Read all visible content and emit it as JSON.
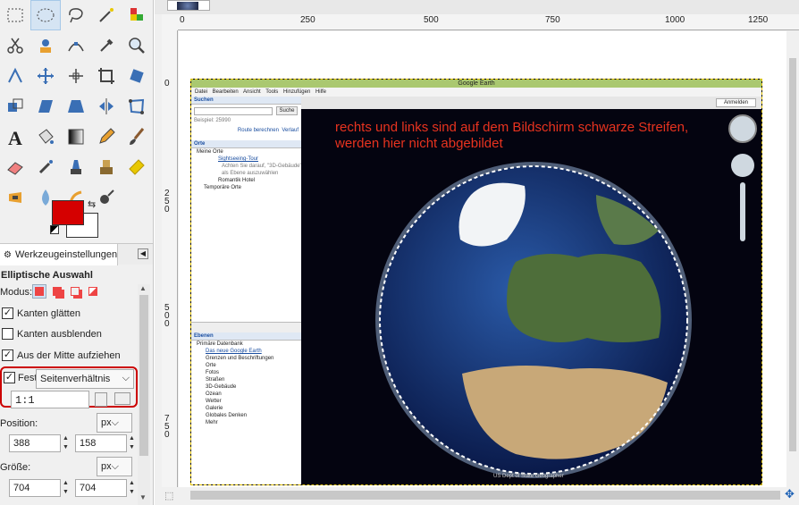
{
  "toolbox": {
    "tools": [
      {
        "icon": "rect-select-icon"
      },
      {
        "icon": "ellipse-select-icon",
        "selected": true
      },
      {
        "icon": "lasso-icon"
      },
      {
        "icon": "fuzzy-select-icon"
      },
      {
        "icon": "color-select-icon"
      },
      {
        "icon": "scissors-icon"
      },
      {
        "icon": "foreground-select-icon"
      },
      {
        "icon": "paths-icon"
      },
      {
        "icon": "color-picker-icon"
      },
      {
        "icon": "zoom-icon"
      },
      {
        "icon": "measure-icon"
      },
      {
        "icon": "move-icon"
      },
      {
        "icon": "align-icon"
      },
      {
        "icon": "crop-icon"
      },
      {
        "icon": "rotate-icon"
      },
      {
        "icon": "scale-icon"
      },
      {
        "icon": "shear-icon"
      },
      {
        "icon": "perspective-icon"
      },
      {
        "icon": "flip-icon"
      },
      {
        "icon": "cage-icon"
      },
      {
        "icon": "text-icon"
      },
      {
        "icon": "bucket-fill-icon"
      },
      {
        "icon": "gradient-icon"
      },
      {
        "icon": "pencil-icon"
      },
      {
        "icon": "paintbrush-icon"
      },
      {
        "icon": "eraser-icon"
      },
      {
        "icon": "airbrush-icon"
      },
      {
        "icon": "ink-icon"
      },
      {
        "icon": "clone-icon"
      },
      {
        "icon": "heal-icon"
      },
      {
        "icon": "perspective-clone-icon"
      },
      {
        "icon": "blur-icon"
      },
      {
        "icon": "smudge-icon"
      },
      {
        "icon": "dodge-burn-icon"
      }
    ],
    "fg_color": "#d50000",
    "bg_color": "#ffffff"
  },
  "tool_options": {
    "tab_label": "Werkzeugeinstellungen",
    "title": "Elliptische Auswahl",
    "mode_label": "Modus:",
    "antialias_label": "Kanten glätten",
    "antialias": true,
    "feather_label": "Kanten ausblenden",
    "feather": false,
    "center_label": "Aus der Mitte aufziehen",
    "center": true,
    "fixed_label": "Fest:",
    "fixed": true,
    "fixed_option": "Seitenverhältnis",
    "ratio_value": "1:1",
    "position_label": "Position:",
    "position_unit": "px",
    "pos_x": "388",
    "pos_y": "158",
    "size_label": "Größe:",
    "size_unit": "px",
    "size_w": "704",
    "size_h": "704"
  },
  "rulers": {
    "h_labels": [
      "0",
      "250",
      "500",
      "750",
      "1000",
      "1250"
    ],
    "v_labels": [
      "0",
      "250",
      "500",
      "750"
    ]
  },
  "google_earth": {
    "title": "Google Earth",
    "menu": "Datei Bearbeiten Ansicht Tools Hinzufügen Hilfe",
    "search_header": "Suchen",
    "search_button": "Suche",
    "search_example": "Beispiel: 25990",
    "route_link": "Route berechnen",
    "history_link": "Verlauf",
    "places_header": "Orte",
    "places": [
      "Meine Orte",
      "Sightseeing-Tour",
      "Achten Sie darauf, \"3D-Gebäude\"",
      "als Ebene auszuwählen",
      "Romantik Hotel",
      "Temporäre Orte"
    ],
    "layers_header": "Ebenen",
    "layers": [
      "Primäre Datenbank",
      "Das neue Google Earth",
      "Grenzen und Beschriftungen",
      "Orte",
      "Fotos",
      "Straßen",
      "3D-Gebäude",
      "Ozean",
      "Wetter",
      "Galerie",
      "Globales Denken",
      "Mehr"
    ],
    "signin": "Anmelden",
    "annotation_line1": "rechts und links sind auf dem Bildschirm schwarze Streifen,",
    "annotation_line2": "werden hier nicht abgebildet",
    "credit": "US Dept of State Geographer"
  }
}
